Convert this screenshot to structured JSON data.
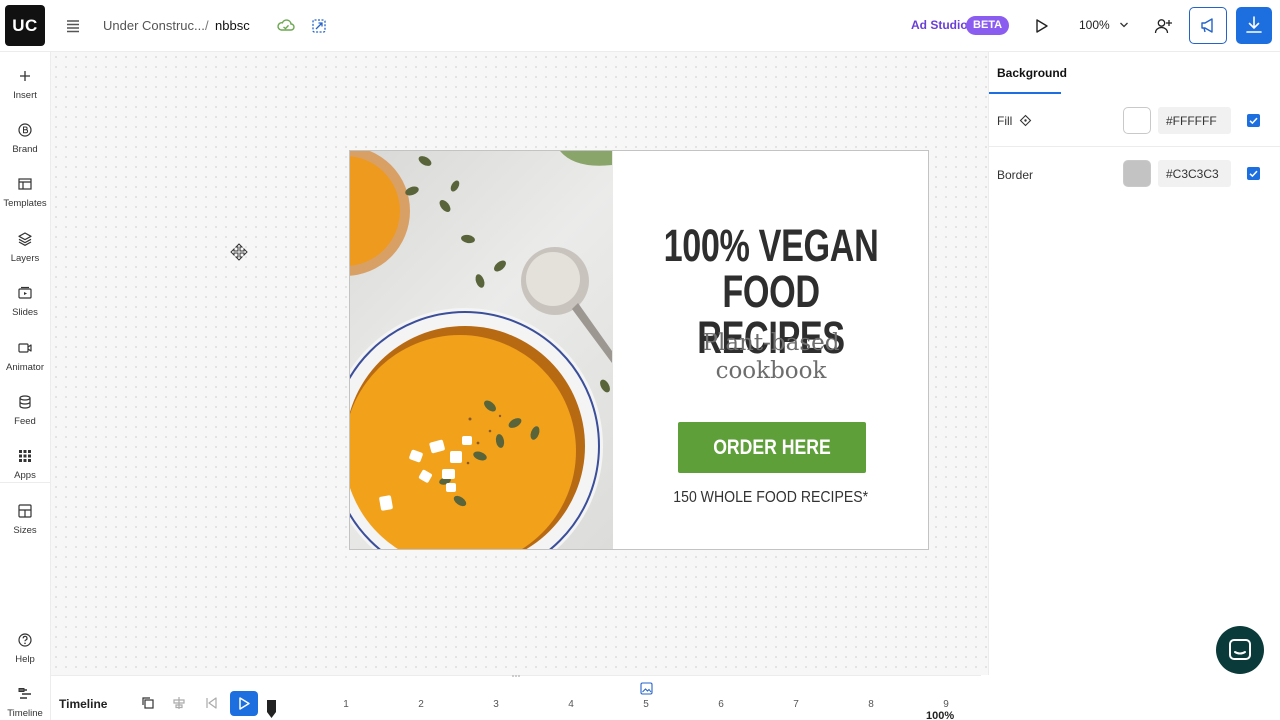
{
  "app": {
    "logo": "UC",
    "breadcrumb": {
      "parent": "Under Construc...",
      "separator": "/",
      "current": "nbbsc"
    },
    "ad_studio": "Ad Studio",
    "beta_badge": "BETA",
    "zoom": "100%"
  },
  "left_nav": [
    {
      "label": "Insert",
      "icon": "plus-icon"
    },
    {
      "label": "Brand",
      "icon": "brand-icon"
    },
    {
      "label": "Templates",
      "icon": "templates-icon"
    },
    {
      "label": "Layers",
      "icon": "layers-icon"
    },
    {
      "label": "Slides",
      "icon": "slides-icon"
    },
    {
      "label": "Animator",
      "icon": "animator-icon"
    },
    {
      "label": "Feed",
      "icon": "database-icon"
    },
    {
      "label": "Apps",
      "icon": "apps-grid-icon"
    },
    {
      "label": "Sizes",
      "icon": "sizes-icon"
    }
  ],
  "left_nav_bottom": [
    {
      "label": "Help",
      "icon": "help-icon"
    },
    {
      "label": "Timeline",
      "icon": "timeline-icon"
    }
  ],
  "banner": {
    "headline": [
      "100% VEGAN",
      "FOOD RECIPES"
    ],
    "subhead": [
      "Plant-based",
      "cookbook"
    ],
    "cta": "ORDER HERE",
    "footnote": "150 WHOLE FOOD RECIPES*"
  },
  "right_panel": {
    "tab": "Background",
    "fill": {
      "label": "Fill",
      "color": "#FFFFFF",
      "hex": "#FFFFFF",
      "checked": true
    },
    "border": {
      "label": "Border",
      "color": "#C3C3C3",
      "hex": "#C3C3C3",
      "checked": true
    }
  },
  "timeline": {
    "title": "Timeline",
    "ticks": [
      "1",
      "2",
      "3",
      "4",
      "5",
      "6",
      "7",
      "8",
      "9"
    ],
    "zoom": "100%"
  },
  "colors": {
    "accent": "#1D6FE0",
    "beta": "#8A5CF0",
    "cta": "#5F9F3A",
    "headline": "#2E2E2E",
    "chat": "#0B3A3A"
  }
}
